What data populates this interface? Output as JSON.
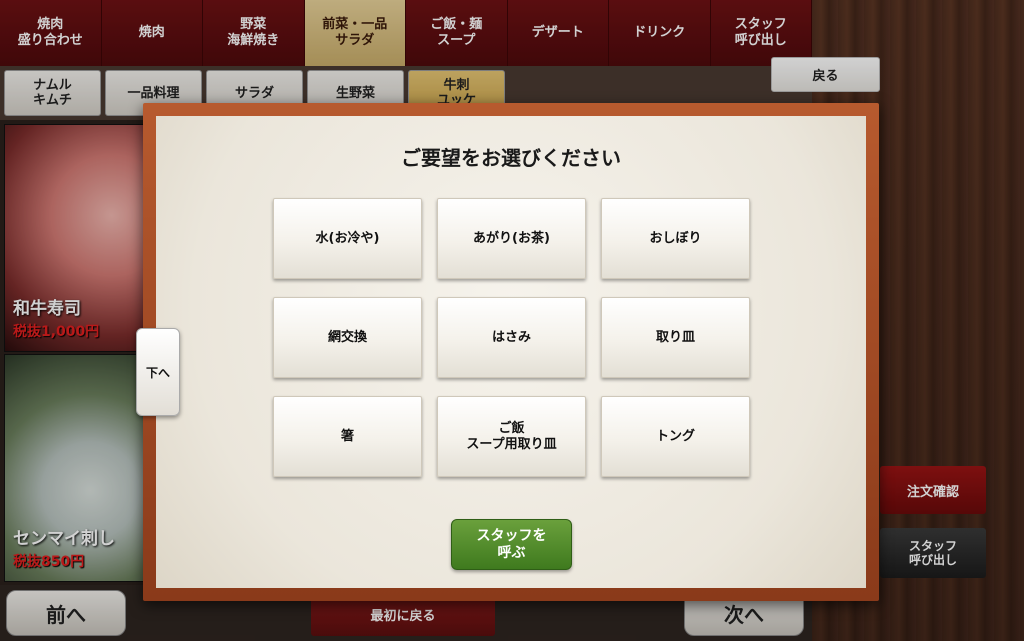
{
  "categories": [
    {
      "label": "焼肉\n盛り合わせ",
      "active": false
    },
    {
      "label": "焼肉",
      "active": false
    },
    {
      "label": "野菜\n海鮮焼き",
      "active": false
    },
    {
      "label": "前菜・一品\nサラダ",
      "active": true
    },
    {
      "label": "ご飯・麺\nスープ",
      "active": false
    },
    {
      "label": "デザート",
      "active": false
    },
    {
      "label": "ドリンク",
      "active": false
    },
    {
      "label": "スタッフ\n呼び出し",
      "active": false
    }
  ],
  "subcategories": [
    {
      "label": "ナムル\nキムチ"
    },
    {
      "label": "一品料理"
    },
    {
      "label": "サラダ"
    },
    {
      "label": "生野菜"
    },
    {
      "label": "牛刺\nユッケ"
    }
  ],
  "products": [
    {
      "name": "和牛寿司",
      "price": "税抜1,000円"
    },
    {
      "name": "センマイ刺し",
      "price": "税抜850円"
    }
  ],
  "nav": {
    "back": "戻る",
    "prev": "前へ",
    "next": "次へ",
    "first": "最初に戻る",
    "down": "下へ"
  },
  "side": {
    "order_confirm": "注文確認",
    "staff_call": "スタッフ\n呼び出し"
  },
  "modal": {
    "title": "ご要望をお選びください",
    "options": [
      "水(お冷や)",
      "あがり(お茶)",
      "おしぼり",
      "網交換",
      "はさみ",
      "取り皿",
      "箸",
      "ご飯\nスープ用取り皿",
      "トング"
    ],
    "call_staff": "スタッフを\n呼ぶ"
  }
}
